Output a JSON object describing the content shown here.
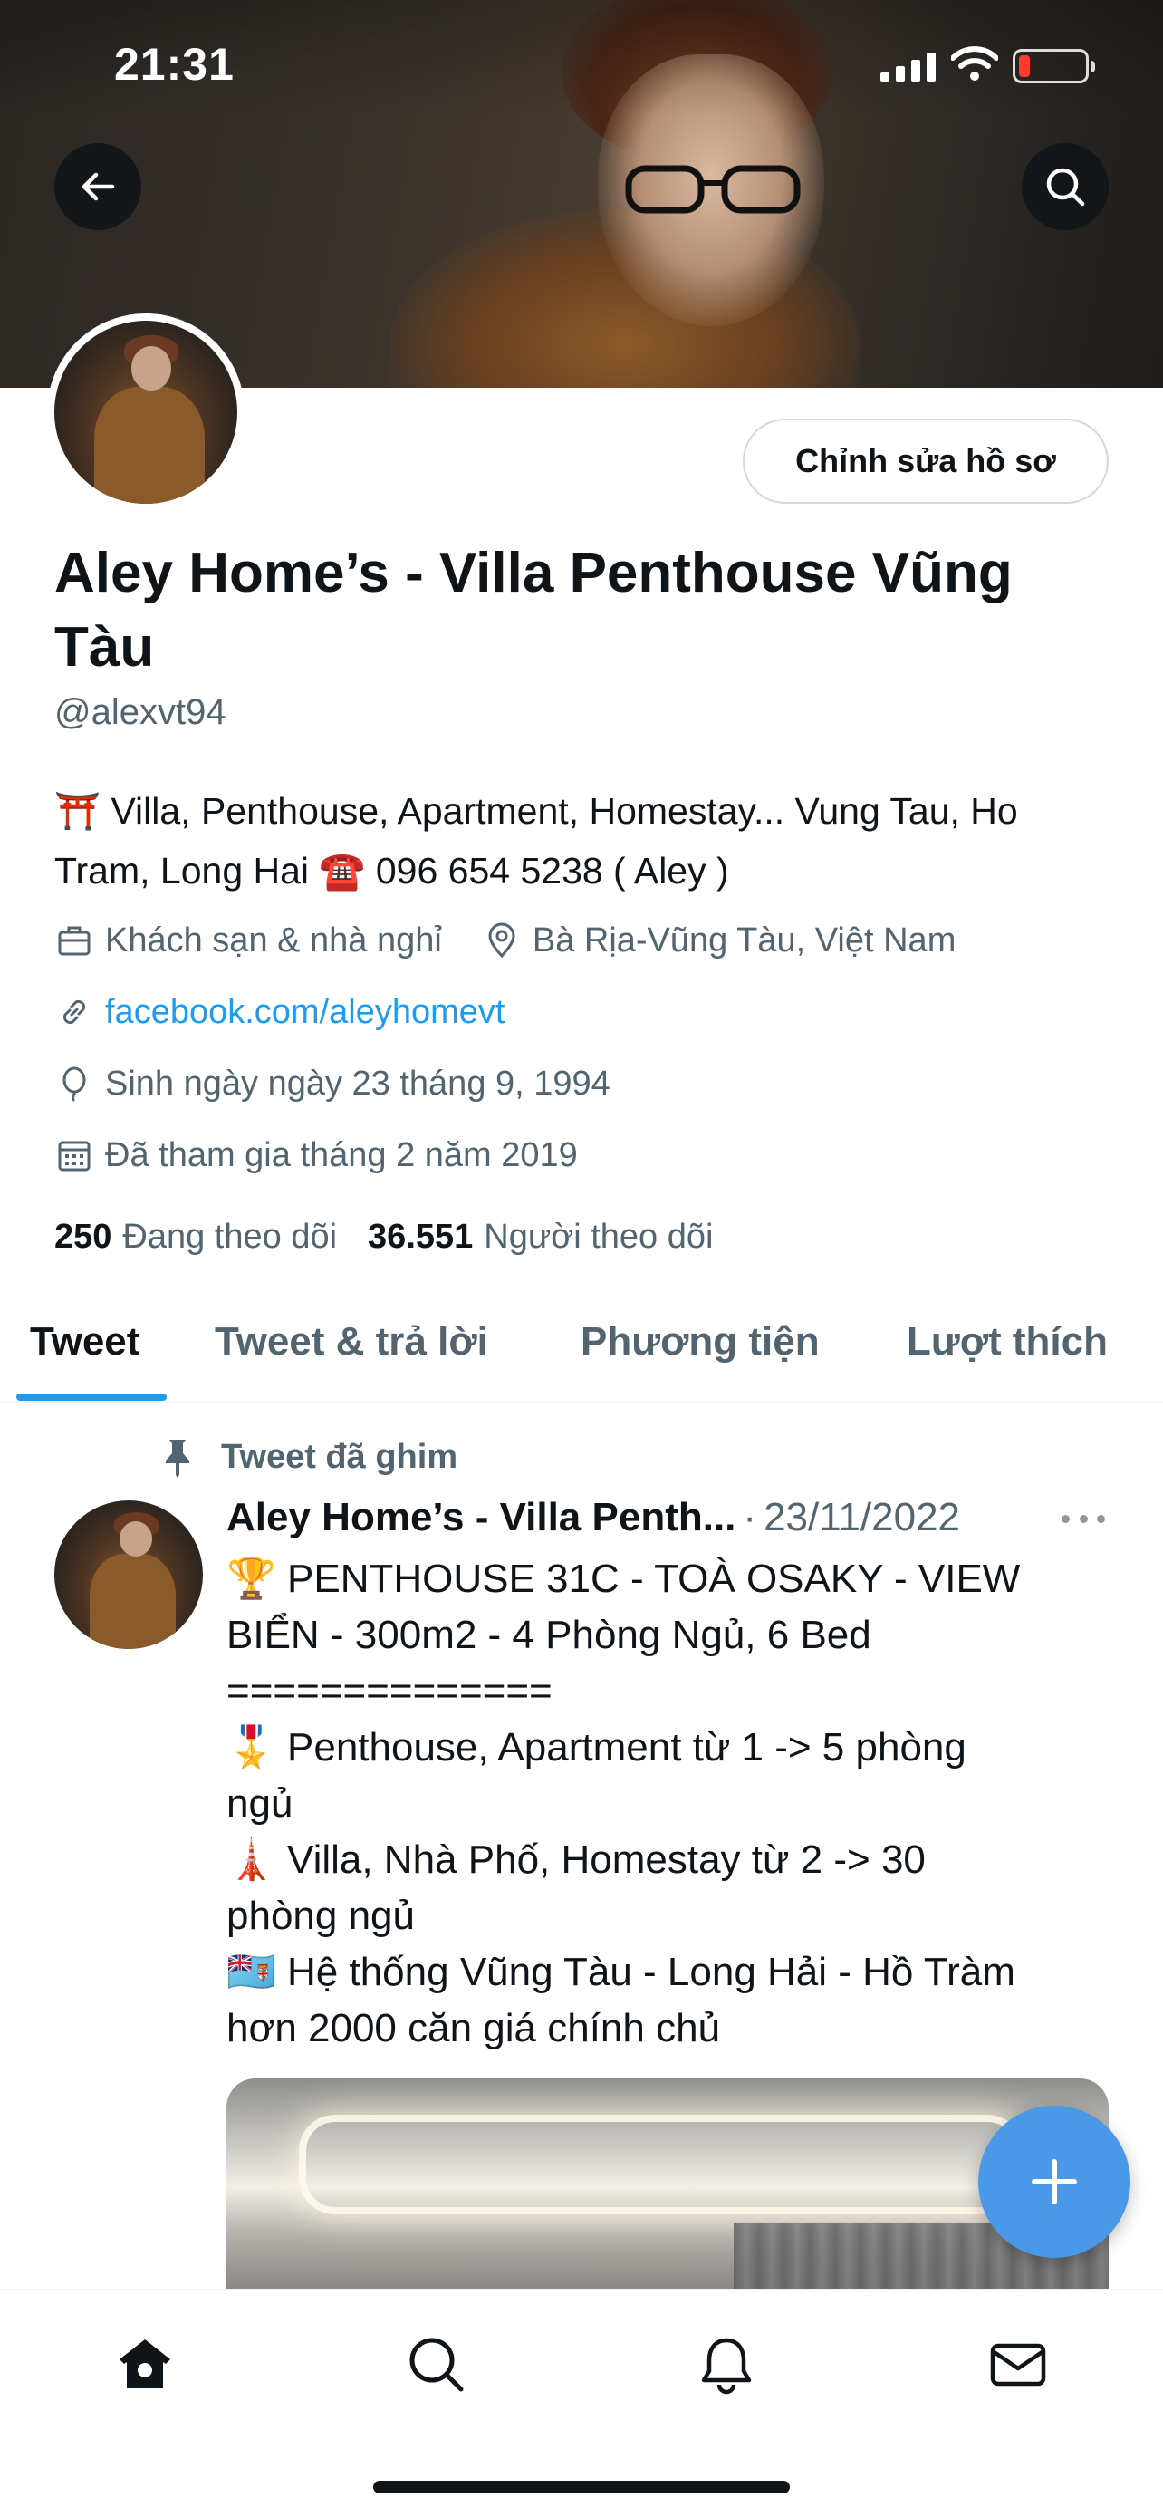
{
  "status_bar": {
    "time": "21:31"
  },
  "header": {
    "back_icon": "arrow-left-icon",
    "search_icon": "search-icon"
  },
  "profile": {
    "edit_button": "Chỉnh sửa hồ sơ",
    "name": "Aley Home’s - Villa Penthouse Vũng Tàu",
    "handle": "@alexvt94",
    "bio": "⛩️ Villa, Penthouse, Apartment, Homestay... Vung Tau, Ho Tram, Long Hai ☎️ 096 654 5238 ( Aley )",
    "category": "Khách sạn & nhà nghỉ",
    "location": "Bà Rịa-Vũng Tàu, Việt Nam",
    "website": "facebook.com/aleyhomevt",
    "birthday": "Sinh ngày ngày 23 tháng 9, 1994",
    "joined": "Đã tham gia tháng 2 năm 2019",
    "following_count": "250",
    "following_label": "Đang theo dõi",
    "followers_count": "36.551",
    "followers_label": "Người theo dõi"
  },
  "tabs": [
    {
      "label": "Tweet"
    },
    {
      "label": "Tweet & trả lời"
    },
    {
      "label": "Phương tiện"
    },
    {
      "label": "Lượt thích"
    }
  ],
  "tweet": {
    "pinned_label": "Tweet đã ghim",
    "author": "Aley Home’s - Villa Penth...",
    "separator": "·",
    "date": "23/11/2022",
    "lines": [
      "🏆 PENTHOUSE 31C - TOÀ OSAKY - VIEW",
      "BIỂN - 300m2 - 4 Phòng Ngủ, 6 Bed",
      "==============",
      "🎖️ Penthouse, Apartment từ 1 -> 5 phòng",
      "ngủ",
      "🗼 Villa, Nhà Phố, Homestay từ 2 -> 30",
      "phòng ngủ",
      "🇫🇯 Hệ thống Vũng Tàu - Long Hải - Hồ Tràm",
      "hơn 2000 căn giá chính chủ"
    ]
  },
  "colors": {
    "accent": "#1d9bf0",
    "secondary_text": "#536471",
    "primary_text": "#0f1419",
    "fab": "#4a99e9"
  },
  "bottom_nav": [
    {
      "icon": "home-icon"
    },
    {
      "icon": "search-icon"
    },
    {
      "icon": "bell-icon"
    },
    {
      "icon": "mail-icon"
    }
  ]
}
